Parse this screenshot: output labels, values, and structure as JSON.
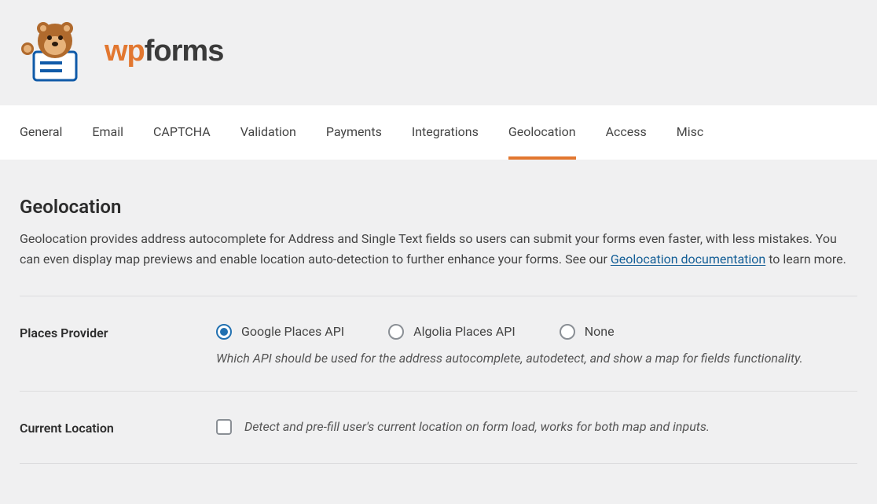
{
  "logo": {
    "wp": "wp",
    "forms": "forms"
  },
  "tabs": {
    "general": "General",
    "email": "Email",
    "captcha": "CAPTCHA",
    "validation": "Validation",
    "payments": "Payments",
    "integrations": "Integrations",
    "geolocation": "Geolocation",
    "access": "Access",
    "misc": "Misc"
  },
  "section": {
    "title": "Geolocation",
    "desc_pre": "Geolocation provides address autocomplete for Address and Single Text fields so users can submit your forms even faster, with less mistakes. You can even display map previews and enable location auto-detection to further enhance your forms. See our ",
    "doc_link_text": "Geolocation documentation",
    "desc_post": " to learn more."
  },
  "places_provider": {
    "label": "Places Provider",
    "options": {
      "google": "Google Places API",
      "algolia": "Algolia Places API",
      "none": "None"
    },
    "help": "Which API should be used for the address autocomplete, autodetect, and show a map for fields functionality."
  },
  "current_location": {
    "label": "Current Location",
    "help": "Detect and pre-fill user's current location on form load, works for both map and inputs."
  }
}
